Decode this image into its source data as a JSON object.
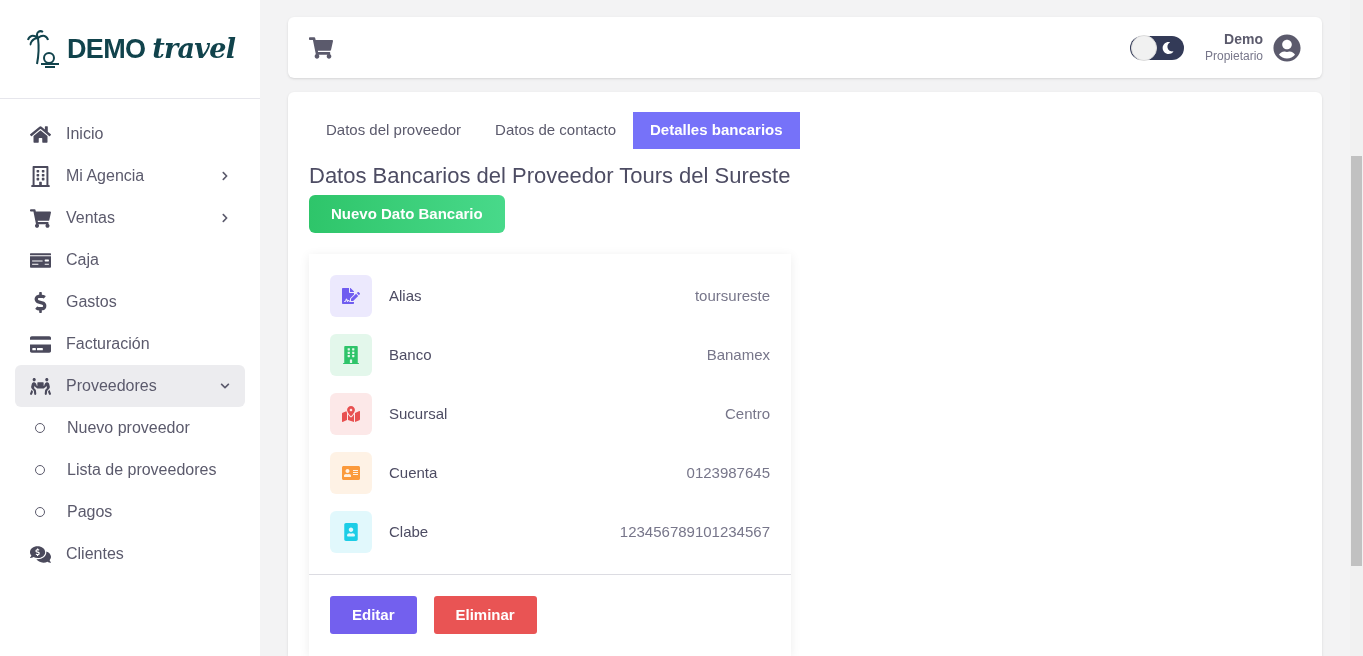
{
  "logo": {
    "word1": "DEMO",
    "word2": "travel"
  },
  "sidebar": {
    "items": [
      {
        "label": "Inicio",
        "selected": false
      },
      {
        "label": "Mi Agencia",
        "selected": false,
        "expanded": false
      },
      {
        "label": "Ventas",
        "selected": false,
        "expanded": false
      },
      {
        "label": "Caja",
        "selected": false
      },
      {
        "label": "Gastos",
        "selected": false
      },
      {
        "label": "Facturación",
        "selected": false
      },
      {
        "label": "Proveedores",
        "selected": true,
        "expanded": true,
        "children": [
          {
            "label": "Nuevo proveedor",
            "selected": false
          },
          {
            "label": "Lista de proveedores",
            "selected": false
          },
          {
            "label": "Pagos",
            "selected": false
          }
        ]
      },
      {
        "label": "Clientes",
        "selected": false
      }
    ]
  },
  "header": {
    "dark_mode": {
      "on": false
    },
    "user": {
      "name": "Demo",
      "role": "Propietario"
    }
  },
  "tabs": [
    {
      "label": "Datos del proveedor",
      "selected": false
    },
    {
      "label": "Datos de contacto",
      "selected": false
    },
    {
      "label": "Detalles bancarios",
      "selected": true
    }
  ],
  "title": "Datos Bancarios del Proveedor Tours del Sureste",
  "new_button": "Nuevo Dato Bancario",
  "details": [
    {
      "label": "Alias",
      "value": "toursureste",
      "color": "#6f5cf0"
    },
    {
      "label": "Banco",
      "value": "Banamex",
      "color": "#2fc46a"
    },
    {
      "label": "Sucursal",
      "value": "Centro",
      "color": "#e85050"
    },
    {
      "label": "Cuenta",
      "value": "0123987645",
      "color": "#fb9a3c"
    },
    {
      "label": "Clabe",
      "value": "123456789101234567",
      "color": "#1ccde6"
    }
  ],
  "actions": [
    {
      "label": "Editar",
      "kind": "edit"
    },
    {
      "label": "Eliminar",
      "kind": "delete"
    }
  ]
}
